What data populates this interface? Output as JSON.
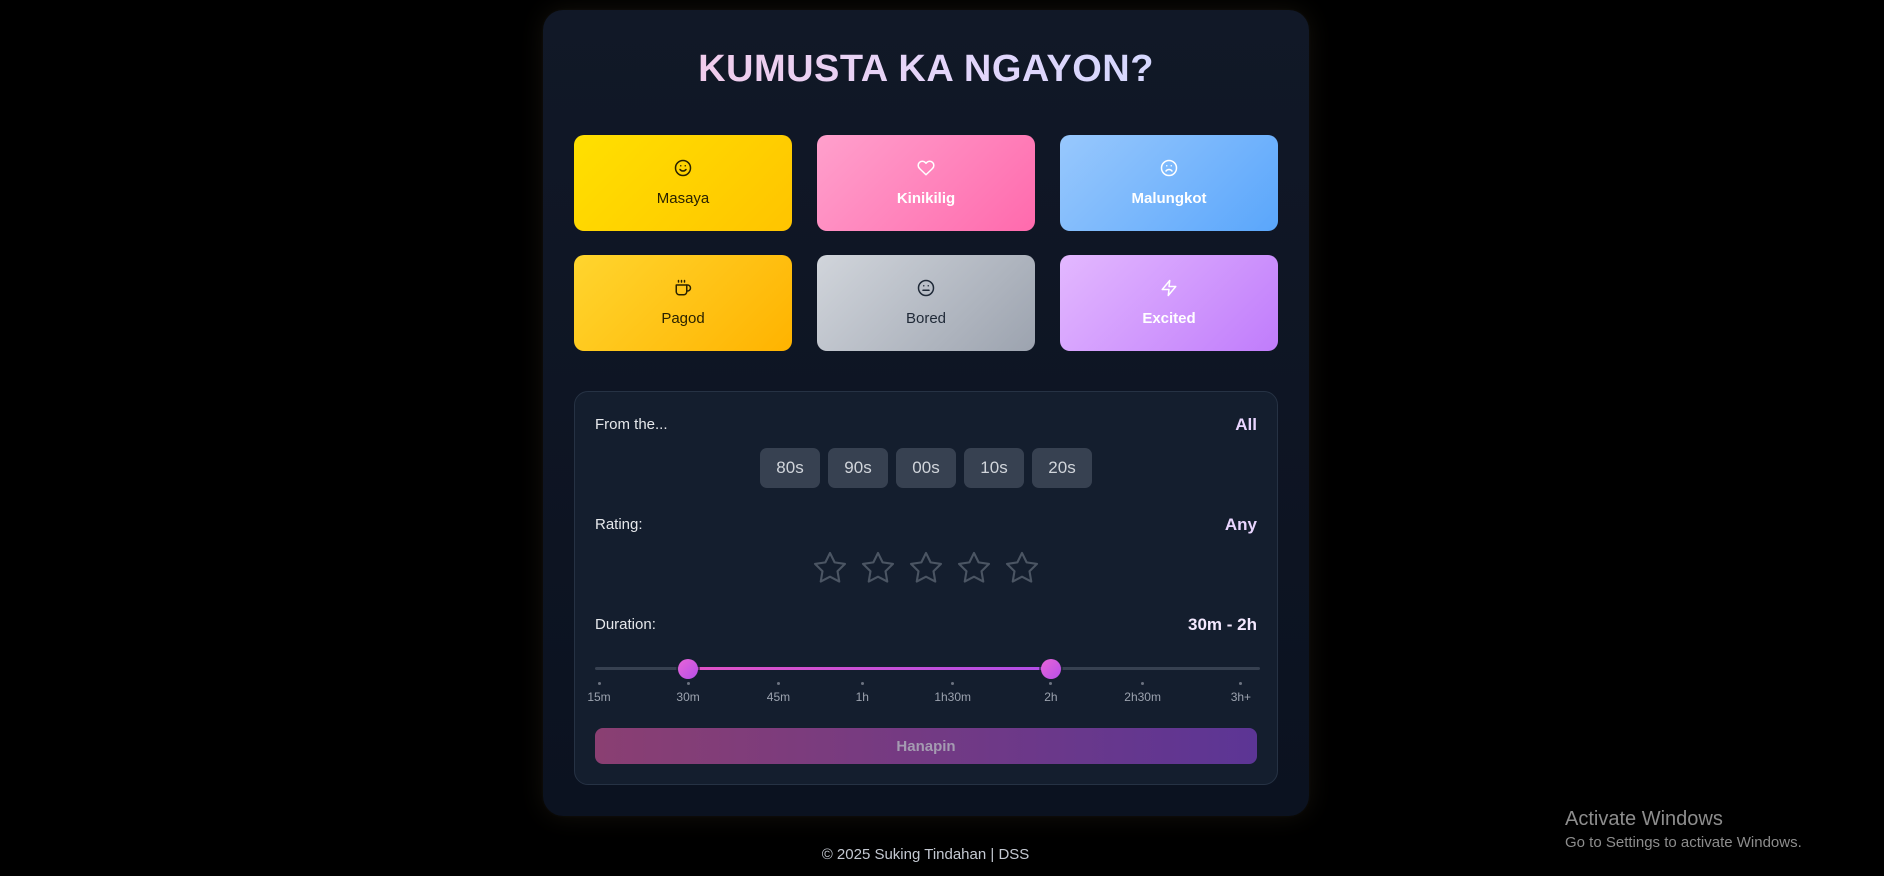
{
  "title": "KUMUSTA KA NGAYON?",
  "moods": [
    {
      "label": "Masaya",
      "icon": "smile-icon"
    },
    {
      "label": "Kinikilig",
      "icon": "heart-icon"
    },
    {
      "label": "Malungkot",
      "icon": "frown-icon"
    },
    {
      "label": "Pagod",
      "icon": "coffee-icon"
    },
    {
      "label": "Bored",
      "icon": "meh-icon"
    },
    {
      "label": "Excited",
      "icon": "zap-icon"
    }
  ],
  "filters": {
    "era_label": "From the...",
    "era_value": "All",
    "eras": [
      "80s",
      "90s",
      "00s",
      "10s",
      "20s"
    ],
    "rating_label": "Rating:",
    "rating_value": "Any",
    "rating_selected": 0,
    "rating_max": 5,
    "duration_label": "Duration:",
    "duration_value": "30m - 2h",
    "duration_ticks": [
      "15m",
      "30m",
      "45m",
      "1h",
      "1h30m",
      "2h",
      "2h30m",
      "3h+"
    ],
    "duration_range_index": [
      1,
      5
    ]
  },
  "search_button": "Hanapin",
  "footer": "© 2025 Suking Tindahan | DSS",
  "watermark": {
    "line1": "Activate Windows",
    "line2": "Go to Settings to activate Windows."
  },
  "colors": {
    "accent_pink": "#e052c5",
    "accent_purple": "#b14ee6",
    "masaya": "#ffd400",
    "kinikilig": "#ff85bd",
    "malungkot": "#7ab8fc",
    "pagod": "#ffc21a",
    "bored": "#b7bcc4",
    "excited": "#d29afd"
  }
}
